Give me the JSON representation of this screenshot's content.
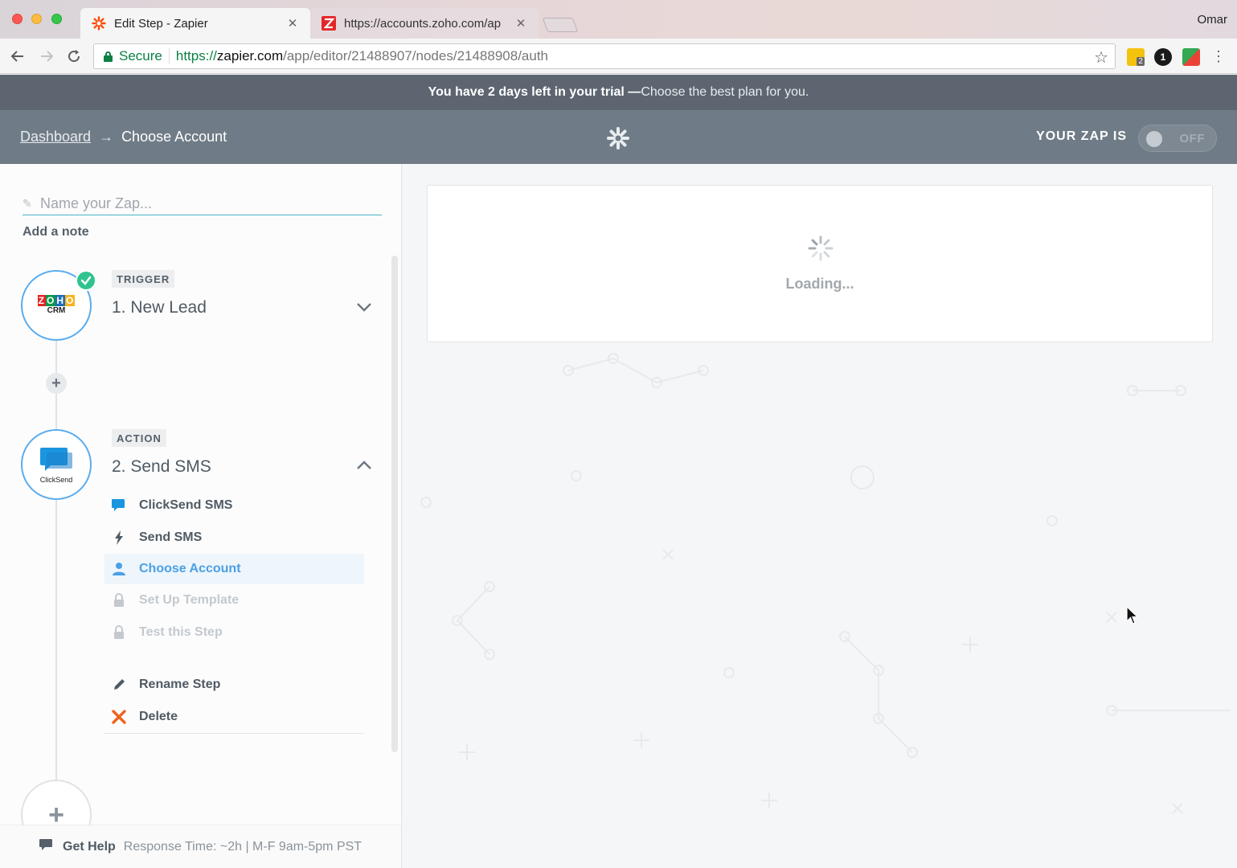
{
  "browser": {
    "tabs": [
      {
        "title": "Edit Step - Zapier",
        "active": true,
        "icon": "zapier-icon"
      },
      {
        "title": "https://accounts.zoho.com/ap",
        "active": false,
        "icon": "zoho-icon"
      }
    ],
    "profile_name": "Omar",
    "secure_label": "Secure",
    "url_scheme": "https://",
    "url_host": "zapier.com",
    "url_path": "/app/editor/21488907/nodes/21488908/auth",
    "extension_badge": "2",
    "onepassword_badge": "1"
  },
  "trial": {
    "strong": "You have 2 days left in your trial —",
    "cta": "Choose the best plan for you."
  },
  "header": {
    "breadcrumb_link": "Dashboard",
    "breadcrumb_arrow": "→",
    "breadcrumb_current": "Choose Account",
    "zap_status_label": "YOUR ZAP IS",
    "toggle_label": "OFF",
    "toggle_on": false
  },
  "sidebar": {
    "zap_name_placeholder": "Name your Zap...",
    "add_note": "Add a note",
    "trigger": {
      "tag": "TRIGGER",
      "title": "1. New Lead",
      "app_logo_text_top": "ZOHO",
      "app_logo_text_bottom": "CRM",
      "completed": true
    },
    "action": {
      "tag": "ACTION",
      "title": "2. Send SMS",
      "app_logo_text": "ClickSend",
      "substeps": [
        {
          "label": "ClickSend SMS",
          "icon": "clicksend-icon",
          "state": "done"
        },
        {
          "label": "Send SMS",
          "icon": "bolt-icon",
          "state": "done"
        },
        {
          "label": "Choose Account",
          "icon": "user-icon",
          "state": "active"
        },
        {
          "label": "Set Up Template",
          "icon": "lock-icon",
          "state": "locked"
        },
        {
          "label": "Test this Step",
          "icon": "lock-icon",
          "state": "locked"
        }
      ],
      "rename_label": "Rename Step",
      "delete_label": "Delete"
    },
    "help": {
      "link": "Get Help",
      "meta": "Response Time: ~2h | M-F 9am-5pm PST"
    }
  },
  "main": {
    "loading_text": "Loading..."
  },
  "colors": {
    "accent": "#4aa0e6",
    "header_bg": "#6f7b86",
    "trial_bg": "#5c6570",
    "success": "#2fc48d",
    "delete": "#f0621e"
  }
}
